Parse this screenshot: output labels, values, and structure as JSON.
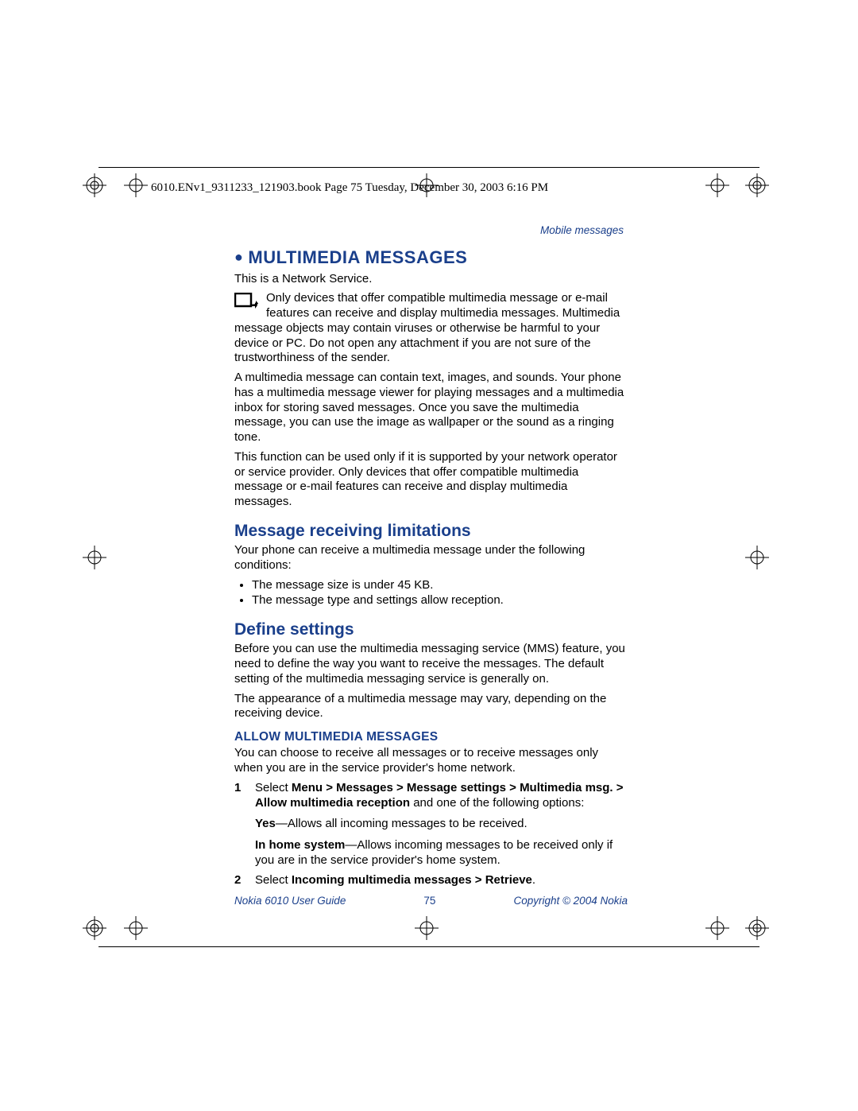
{
  "print_header": "6010.ENv1_9311233_121903.book  Page 75  Tuesday, December 30, 2003  6:16 PM",
  "running_head": "Mobile messages",
  "h1": "MULTIMEDIA MESSAGES",
  "intro1": "This is a Network Service.",
  "note": "Only devices that offer compatible multimedia message or e-mail features can receive and display multimedia messages. Multimedia message objects may contain viruses or otherwise be harmful to your device or PC. Do not open any attachment if you are not sure of the trustworthiness of the sender.",
  "para_a": "A multimedia message can contain text, images, and sounds. Your phone has a multimedia message viewer for playing messages and a multimedia inbox for storing saved messages. Once you save the multimedia message, you can use the image as wallpaper or the sound as a ringing tone.",
  "para_b": "This function can be used only if it is supported by your network operator or service provider. Only devices that offer compatible multimedia message or e-mail features can receive and display multimedia messages.",
  "h2a": "Message receiving limitations",
  "mrl_intro": "Your phone can receive a multimedia message under the following conditions:",
  "mrl_b1": "The message size is under 45 KB.",
  "mrl_b2": "The message type and settings allow reception.",
  "h2b": "Define settings",
  "ds_p1": "Before you can use the multimedia messaging service (MMS) feature, you need to define the way you want to receive the messages. The default setting of the multimedia messaging service is generally on.",
  "ds_p2": "The appearance of a multimedia message may vary, depending on the receiving device.",
  "h3a": "ALLOW MULTIMEDIA MESSAGES",
  "amm_p1": "You can choose to receive all messages or to receive messages only when you are in the service provider's home network.",
  "step1_num": "1",
  "step1_pre": "Select ",
  "step1_bold": "Menu > Messages > Message settings > Multimedia msg. > Allow multimedia reception",
  "step1_post": " and one of the following options:",
  "step1_opt1_b": "Yes",
  "step1_opt1_t": "—Allows all incoming messages to be received.",
  "step1_opt2_b": "In home system",
  "step1_opt2_t": "—Allows incoming messages to be received only if you are in the service provider's home system.",
  "step2_num": "2",
  "step2_pre": "Select ",
  "step2_bold": "Incoming multimedia messages > Retrieve",
  "step2_post": ".",
  "footer_left": "Nokia 6010 User Guide",
  "footer_page": "75",
  "footer_right": "Copyright © 2004 Nokia"
}
